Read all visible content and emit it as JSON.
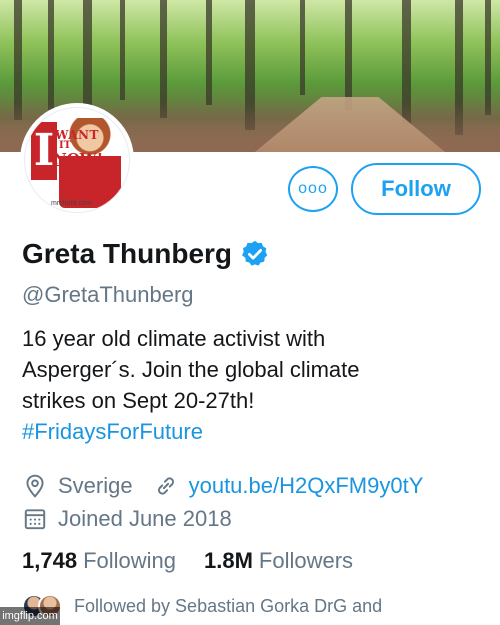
{
  "banner": {
    "description_icon": "forest-banner"
  },
  "avatar": {
    "big_letter": "I",
    "want": "WANT",
    "it": "IT",
    "now": "NOW!",
    "credit": "mrchord.com"
  },
  "actions": {
    "more_label": "ooo",
    "follow_label": "Follow"
  },
  "profile": {
    "name": "Greta Thunberg",
    "handle": "@GretaThunberg",
    "bio_line1": "16 year old climate activist with",
    "bio_line2": "Asperger´s.  Join the global climate",
    "bio_line3": "strikes on Sept 20-27th!",
    "hashtag": "#FridaysForFuture"
  },
  "meta": {
    "location": "Sverige",
    "link": "youtu.be/H2QxFM9y0tY",
    "joined": "Joined June 2018"
  },
  "stats": {
    "following_count": "1,748",
    "following_label": "Following",
    "followers_count": "1.8M",
    "followers_label": "Followers"
  },
  "followed_by": "Followed by Sebastian Gorka DrG and",
  "watermark": "imgflip.com",
  "colors": {
    "accent": "#1da1f2",
    "link": "#1b95e0",
    "secondary": "#657786",
    "primary": "#14171a"
  }
}
